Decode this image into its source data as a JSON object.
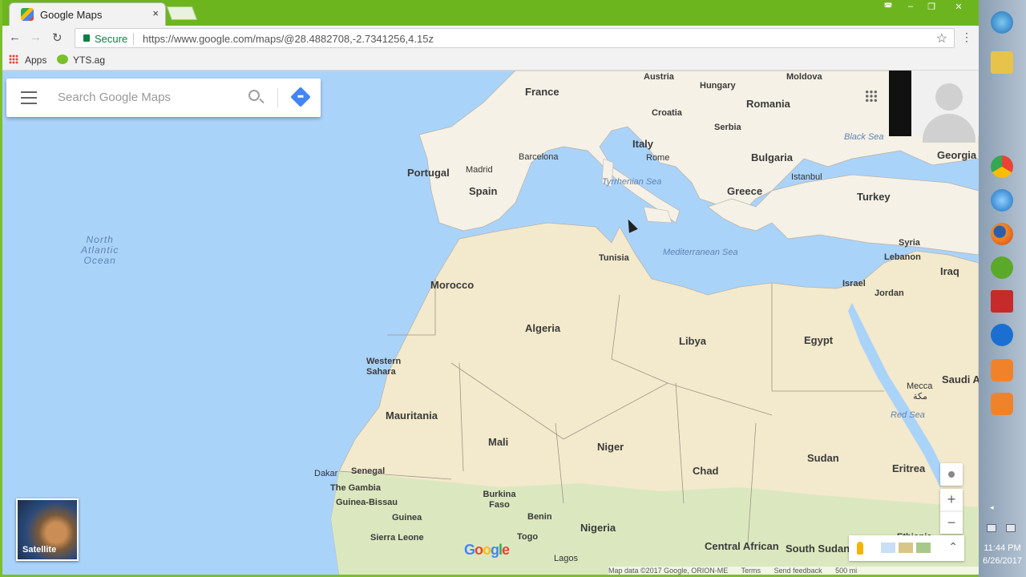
{
  "browser": {
    "tab_title": "Google Maps",
    "tab_close": "×",
    "secure_label": "Secure",
    "url": "https://www.google.com/maps/@28.4882708,-2.7341256,4.15z",
    "bookmarks": [
      "Apps",
      "YTS.ag"
    ]
  },
  "maps": {
    "search_placeholder": "Search Google Maps",
    "satellite_label": "Satellite",
    "zoom_in": "+",
    "zoom_out": "−",
    "logo": "Google",
    "footer": [
      "Map data ©2017 Google, ORION-ME",
      "Terms",
      "Send feedback",
      "500 mi"
    ],
    "countries": [
      "France",
      "Portugal",
      "Spain",
      "Italy",
      "Croatia",
      "Serbia",
      "Bulgaria",
      "Greece",
      "Turkey",
      "Georgia",
      "Romania",
      "Hungary",
      "Austria",
      "Moldova",
      "Tunisia",
      "Morocco",
      "Algeria",
      "Libya",
      "Egypt",
      "Western Sahara",
      "Mauritania",
      "Mali",
      "Niger",
      "Chad",
      "Sudan",
      "Eritrea",
      "Senegal",
      "The Gambia",
      "Guinea-Bissau",
      "Guinea",
      "Sierra Leone",
      "Burkina Faso",
      "Benin",
      "Togo",
      "Nigeria",
      "Central African",
      "South Sudan",
      "Saudi Arabia",
      "Syria",
      "Lebanon",
      "Israel",
      "Jordan",
      "Iraq",
      "Ethiopia"
    ],
    "cities": [
      "Madrid",
      "Barcelona",
      "Rome",
      "Istanbul",
      "Dakar",
      "Lagos",
      "Mecca",
      "مكة"
    ],
    "seas": [
      "Tyrrhenian Sea",
      "Mediterranean Sea",
      "Black Sea",
      "Red Sea"
    ],
    "ocean": "North Atlantic Ocean",
    "ocean_lines": [
      "North",
      "Atlantic",
      "Ocean"
    ]
  },
  "taskbar": {
    "time": "11:44 PM",
    "date": "6/26/2017",
    "icons": [
      "windows-start",
      "file-explorer",
      "chrome",
      "internet-explorer",
      "firefox",
      "utorrent",
      "tools",
      "malwarebytes",
      "ring-app",
      "ring-app"
    ]
  },
  "colors": {
    "water": "#aad3fa",
    "land": "#f5f1e6",
    "desert": "#f3e6c3",
    "green": "#d6e8b5",
    "accent": "#4285f4"
  }
}
